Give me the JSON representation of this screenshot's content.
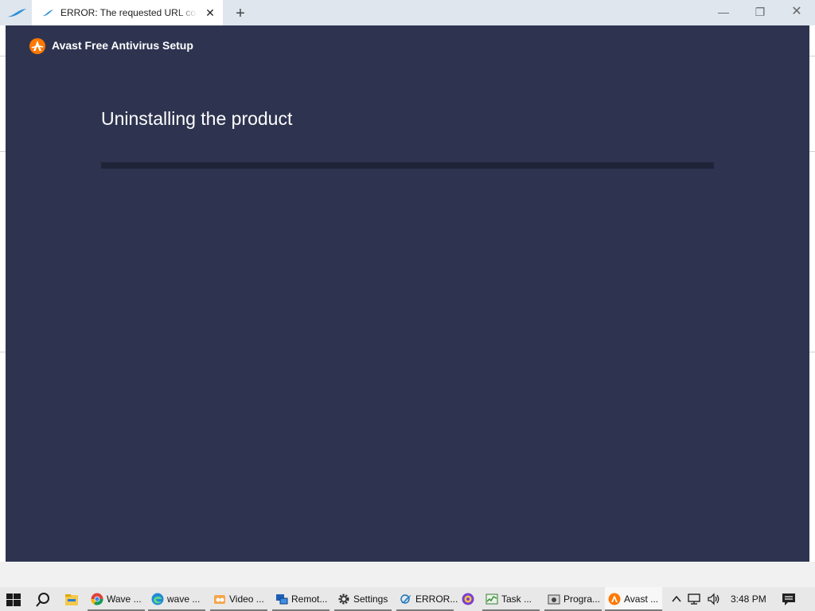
{
  "browser": {
    "tab_title": "ERROR: The requested URL could not be retrieved",
    "tab_close": "✕",
    "new_tab": "+",
    "window_controls": {
      "minimize": "—",
      "restore": "❐",
      "close": "✕"
    }
  },
  "setup_window": {
    "title": "Avast Free Antivirus Setup",
    "heading": "Uninstalling the product",
    "progress_fraction": 0.0,
    "colors": {
      "background": "#2e3450",
      "track": "#1f2438",
      "accent": "#ff7800"
    }
  },
  "taskbar": {
    "items": [
      {
        "label": "Wave ...",
        "icon": "chrome-icon"
      },
      {
        "label": "wave ...",
        "icon": "edge-icon"
      },
      {
        "label": "Video ...",
        "icon": "video-app-icon"
      },
      {
        "label": "Remot...",
        "icon": "remote-desktop-icon"
      },
      {
        "label": "Settings",
        "icon": "gear-icon"
      },
      {
        "label": "ERROR...",
        "icon": "browser-icon"
      },
      {
        "label": "",
        "icon": "purple-app-icon"
      },
      {
        "label": "Task ...",
        "icon": "task-manager-icon"
      },
      {
        "label": "Progra...",
        "icon": "programs-icon"
      },
      {
        "label": "Avast ...",
        "icon": "avast-icon"
      }
    ],
    "clock": "3:48 PM"
  }
}
